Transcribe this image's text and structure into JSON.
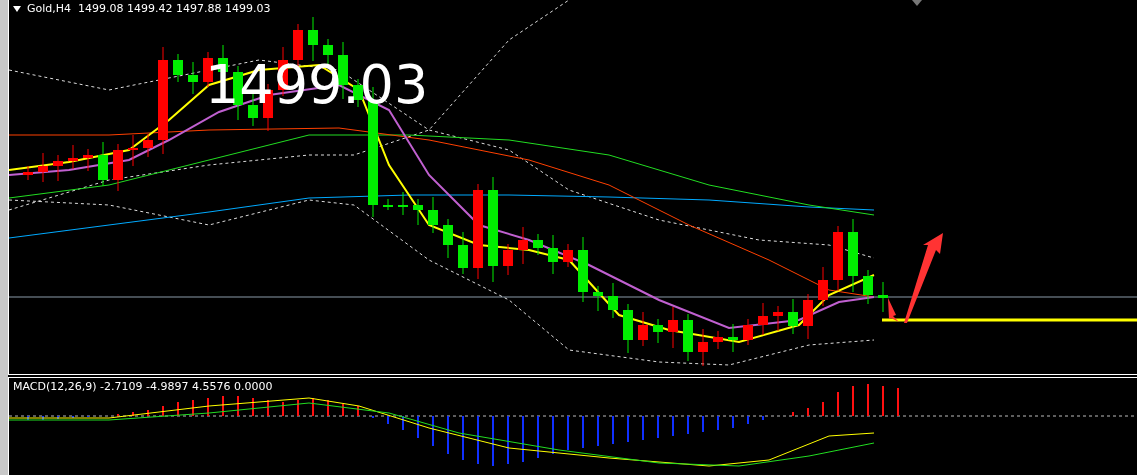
{
  "main_chart": {
    "header": "Gold,H4  1499.08 1499.42 1497.88 1499.03",
    "price_overlay": "1499.03"
  },
  "indicator": {
    "header": "MACD(12,26,9) -2.7109 -4.9897 4.5576 0.0000"
  }
}
